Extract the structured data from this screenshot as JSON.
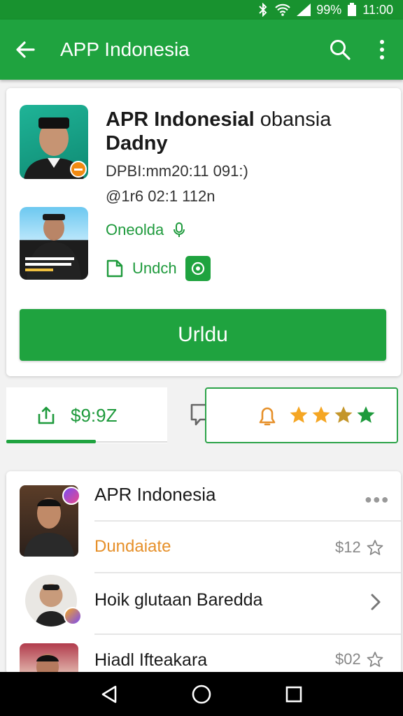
{
  "status_bar": {
    "battery": "99%",
    "time": "11:00"
  },
  "app_bar": {
    "title": "APP Indonesia",
    "icons": [
      "arrow-back-icon",
      "search-icon",
      "more-vert-icon"
    ]
  },
  "card": {
    "name_bold": "APR Indonesial",
    "name_tail": " obansia",
    "name_line2": "Dadny",
    "meta_line1": "DPBI:mm20:11 091:)",
    "meta_line2": "@1r6 02:1 112n",
    "status_text": "Oneolda",
    "undo_text": "Undch",
    "primary_button": "Urldu"
  },
  "tabs": {
    "left_value": "$9:9Z",
    "rating_stars": 4,
    "icons": [
      "share-icon",
      "comment-icon",
      "bell-icon",
      "star-icon"
    ]
  },
  "list": [
    {
      "title": "APR Indonesia",
      "subtitle": "Dundaiate",
      "price": "$12"
    },
    {
      "title": "Hoik glutaan Baredda"
    },
    {
      "title": "Hiadl Ifteakara",
      "price": "$02"
    }
  ],
  "colors": {
    "primary": "#1fa33f",
    "status_bar": "#18922f",
    "accent_orange": "#e6902a",
    "star_gold": "#f5a623",
    "star_green": "#1e9a3c"
  }
}
